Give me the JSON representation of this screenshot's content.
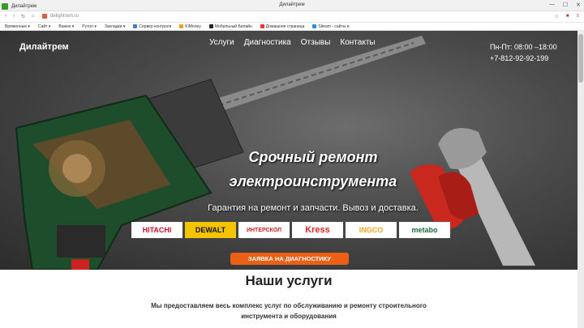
{
  "browser": {
    "tab_title": "Дилайтрем",
    "window_title": "Дилайтрем",
    "url": "delightrem.ru",
    "window_controls": [
      "—",
      "☐",
      "✕"
    ],
    "bookmarks": [
      "Временные",
      "Сайт",
      "Важно",
      "Рутол",
      "Закладки",
      "Сервер контроля",
      "KiMoney",
      "Мобильный Билайн",
      "Домашняя страница",
      "Siteam - сайты и"
    ]
  },
  "site": {
    "logo": "Дилайтрем",
    "menu": [
      "Услуги",
      "Диагностика",
      "Отзывы",
      "Контакты"
    ],
    "hours": "Пн-Пт: 08:00 –18:00",
    "phone": "+7-812-92-92-199"
  },
  "hero": {
    "headline_line1": "Срочный ремонт",
    "headline_line2": "электроинструмента",
    "subline": "Гарантия на ремонт и запчасти. Вывоз и доставка.",
    "brands": [
      {
        "name": "HITACHI",
        "color": "#c8102e"
      },
      {
        "name": "DEWALT",
        "color": "#111111"
      },
      {
        "name": "ИНТЕРСКОЛ",
        "color": "#d01f25"
      },
      {
        "name": "Kress",
        "color": "#e1261c"
      },
      {
        "name": "INGCO",
        "color": "#f3a51f"
      },
      {
        "name": "metabo",
        "color": "#1b6c3b"
      }
    ],
    "cta": "ЗАЯВКА НА ДИАГНОСТИКУ",
    "cta_color": "#ec5f17"
  },
  "services": {
    "title": "Наши услуги",
    "text": "Мы предоставляем весь комплекс услуг по обслуживанию и ремонту строительного инструмента и оборудования"
  }
}
